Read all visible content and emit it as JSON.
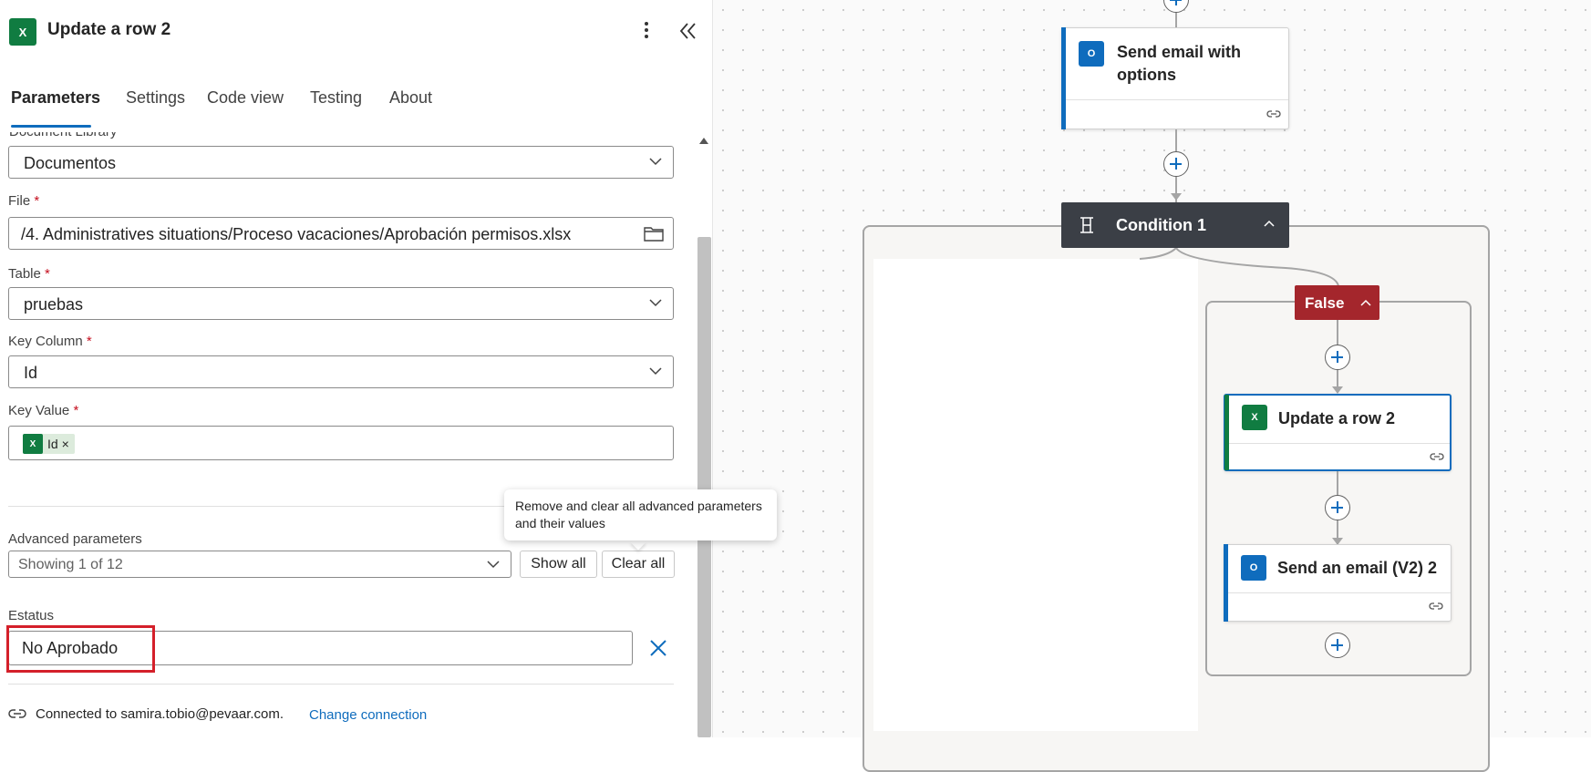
{
  "panel": {
    "title": "Update a row 2",
    "app_icon": "excel-icon",
    "tabs": [
      "Parameters",
      "Settings",
      "Code view",
      "Testing",
      "About"
    ],
    "active_tab": "Parameters",
    "fields": {
      "document_library_label": "Document Library",
      "document_library_value": "Documentos",
      "file_label": "File",
      "file_value": "/4. Administratives situations/Proceso vacaciones/Aprobación permisos.xlsx",
      "table_label": "Table",
      "table_value": "pruebas",
      "key_column_label": "Key Column",
      "key_column_value": "Id",
      "key_value_label": "Key Value",
      "key_value_token": "Id",
      "required_marker": "*"
    },
    "advanced": {
      "label": "Advanced parameters",
      "dropdown_value": "Showing 1 of 12",
      "show_all": "Show all",
      "clear_all": "Clear all"
    },
    "estatus": {
      "label": "Estatus",
      "value": "No Aprobado"
    },
    "connection": {
      "text": "Connected to samira.tobio@pevaar.com.",
      "link": "Change connection"
    },
    "tooltip": "Remove and clear all advanced parameters and their values"
  },
  "canvas": {
    "cards": {
      "send_email_options": "Send email with options",
      "condition": "Condition 1",
      "false_branch": "False",
      "update_row": "Update a row 2",
      "send_email_v2": "Send an email (V2) 2"
    },
    "colors": {
      "excel": "#107c41",
      "outlook": "#0f6cbd",
      "condition_header": "#3b3f46",
      "false_header": "#a4262c",
      "highlight_box": "#d4202a"
    }
  }
}
